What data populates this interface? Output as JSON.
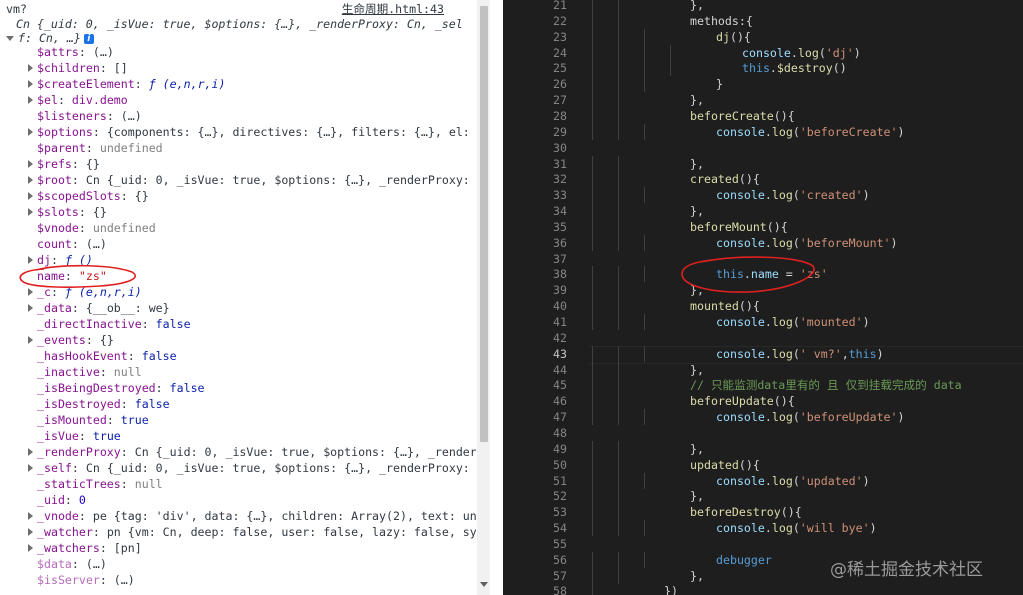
{
  "console": {
    "header": {
      "prompt": "vm?",
      "source_link": "生命周期.html:43"
    },
    "summary": "Cn {_uid: 0, _isVue: true, $options: {…}, _renderProxy: Cn, _sel",
    "summary2": "f: Cn, …}",
    "info_icon": "i",
    "rows": [
      {
        "tri": "none",
        "key": "$attrs",
        "sep": ": ",
        "val": "(…)",
        "vt": "obj"
      },
      {
        "tri": "closed",
        "key": "$children",
        "sep": ": ",
        "val": "[]",
        "vt": "obj"
      },
      {
        "tri": "closed",
        "key": "$createElement",
        "sep": ": ",
        "val": "ƒ (e,n,r,i)",
        "vt": "fn"
      },
      {
        "tri": "closed",
        "key": "$el",
        "sep": ": ",
        "val": "div.demo",
        "vt": "elem"
      },
      {
        "tri": "none",
        "key": "$listeners",
        "sep": ": ",
        "val": "(…)",
        "vt": "obj"
      },
      {
        "tri": "closed",
        "key": "$options",
        "sep": ": ",
        "val": "{components: {…}, directives: {…}, filters: {…}, el:",
        "vt": "obj"
      },
      {
        "tri": "none",
        "key": "$parent",
        "sep": ": ",
        "val": "undefined",
        "vt": "null"
      },
      {
        "tri": "closed",
        "key": "$refs",
        "sep": ": ",
        "val": "{}",
        "vt": "obj"
      },
      {
        "tri": "closed",
        "key": "$root",
        "sep": ": ",
        "val": "Cn {_uid: 0, _isVue: true, $options: {…}, _renderProxy:",
        "vt": "obj"
      },
      {
        "tri": "closed",
        "key": "$scopedSlots",
        "sep": ": ",
        "val": "{}",
        "vt": "obj"
      },
      {
        "tri": "closed",
        "key": "$slots",
        "sep": ": ",
        "val": "{}",
        "vt": "obj"
      },
      {
        "tri": "none",
        "key": "$vnode",
        "sep": ": ",
        "val": "undefined",
        "vt": "null"
      },
      {
        "tri": "none",
        "key": "count",
        "sep": ": ",
        "val": "(…)",
        "vt": "obj"
      },
      {
        "tri": "closed",
        "key": "dj",
        "sep": ": ",
        "val": "ƒ ()",
        "vt": "fn"
      },
      {
        "tri": "none",
        "key": "name",
        "sep": ": ",
        "val": "\"zs\"",
        "vt": "str"
      },
      {
        "tri": "closed",
        "key": "_c",
        "sep": ": ",
        "val": "ƒ (e,n,r,i)",
        "vt": "fn"
      },
      {
        "tri": "closed",
        "key": "_data",
        "sep": ": ",
        "val": "{__ob__: we}",
        "vt": "obj"
      },
      {
        "tri": "none",
        "key": "_directInactive",
        "sep": ": ",
        "val": "false",
        "vt": "kw"
      },
      {
        "tri": "closed",
        "key": "_events",
        "sep": ": ",
        "val": "{}",
        "vt": "obj"
      },
      {
        "tri": "none",
        "key": "_hasHookEvent",
        "sep": ": ",
        "val": "false",
        "vt": "kw"
      },
      {
        "tri": "none",
        "key": "_inactive",
        "sep": ": ",
        "val": "null",
        "vt": "null"
      },
      {
        "tri": "none",
        "key": "_isBeingDestroyed",
        "sep": ": ",
        "val": "false",
        "vt": "kw"
      },
      {
        "tri": "none",
        "key": "_isDestroyed",
        "sep": ": ",
        "val": "false",
        "vt": "kw"
      },
      {
        "tri": "none",
        "key": "_isMounted",
        "sep": ": ",
        "val": "true",
        "vt": "kw"
      },
      {
        "tri": "none",
        "key": "_isVue",
        "sep": ": ",
        "val": "true",
        "vt": "kw"
      },
      {
        "tri": "closed",
        "key": "_renderProxy",
        "sep": ": ",
        "val": "Cn {_uid: 0, _isVue: true, $options: {…}, _render",
        "vt": "obj"
      },
      {
        "tri": "closed",
        "key": "_self",
        "sep": ": ",
        "val": "Cn {_uid: 0, _isVue: true, $options: {…}, _renderProxy:",
        "vt": "obj"
      },
      {
        "tri": "none",
        "key": "_staticTrees",
        "sep": ": ",
        "val": "null",
        "vt": "null"
      },
      {
        "tri": "none",
        "key": "_uid",
        "sep": ": ",
        "val": "0",
        "vt": "num"
      },
      {
        "tri": "closed",
        "key": "_vnode",
        "sep": ": ",
        "val": "pe {tag: 'div', data: {…}, children: Array(2), text: un",
        "vt": "obj"
      },
      {
        "tri": "closed",
        "key": "_watcher",
        "sep": ": ",
        "val": "pn {vm: Cn, deep: false, user: false, lazy: false, sy",
        "vt": "obj"
      },
      {
        "tri": "closed",
        "key": "_watchers",
        "sep": ": ",
        "val": "[pn]",
        "vt": "obj"
      },
      {
        "tri": "none",
        "key": "$data",
        "sep": ": ",
        "val": "(…)",
        "vt": "obj",
        "dim": true
      },
      {
        "tri": "none",
        "key": "$isServer",
        "sep": ": ",
        "val": "(…)",
        "vt": "obj",
        "dim": true
      }
    ]
  },
  "editor": {
    "lines": [
      {
        "n": "21",
        "indent": 3,
        "tokens": [
          [
            "p",
            "},"
          ]
        ]
      },
      {
        "n": "22",
        "indent": 3,
        "tokens": [
          [
            "p",
            "methods:{"
          ]
        ]
      },
      {
        "n": "23",
        "indent": 4,
        "tokens": [
          [
            "fn",
            "dj"
          ],
          [
            "p",
            "(){"
          ]
        ]
      },
      {
        "n": "24",
        "indent": 5,
        "tokens": [
          [
            "v",
            "console"
          ],
          [
            "p",
            "."
          ],
          [
            "fn",
            "log"
          ],
          [
            "p",
            "("
          ],
          [
            "s",
            "'dj'"
          ],
          [
            "p",
            ")"
          ]
        ]
      },
      {
        "n": "25",
        "indent": 5,
        "tokens": [
          [
            "k",
            "this"
          ],
          [
            "p",
            "."
          ],
          [
            "fn",
            "$destroy"
          ],
          [
            "p",
            "()"
          ]
        ]
      },
      {
        "n": "26",
        "indent": 4,
        "tokens": [
          [
            "p",
            "}"
          ]
        ]
      },
      {
        "n": "27",
        "indent": 3,
        "tokens": [
          [
            "p",
            "},"
          ]
        ]
      },
      {
        "n": "28",
        "indent": 3,
        "tokens": [
          [
            "fn",
            "beforeCreate"
          ],
          [
            "p",
            "(){"
          ]
        ]
      },
      {
        "n": "29",
        "indent": 4,
        "tokens": [
          [
            "v",
            "console"
          ],
          [
            "p",
            "."
          ],
          [
            "fn",
            "log"
          ],
          [
            "p",
            "("
          ],
          [
            "s",
            "'beforeCreate'"
          ],
          [
            "p",
            ")"
          ]
        ]
      },
      {
        "n": "30",
        "indent": 0,
        "tokens": []
      },
      {
        "n": "31",
        "indent": 3,
        "tokens": [
          [
            "p",
            "},"
          ]
        ]
      },
      {
        "n": "32",
        "indent": 3,
        "tokens": [
          [
            "fn",
            "created"
          ],
          [
            "p",
            "(){"
          ]
        ]
      },
      {
        "n": "33",
        "indent": 4,
        "tokens": [
          [
            "v",
            "console"
          ],
          [
            "p",
            "."
          ],
          [
            "fn",
            "log"
          ],
          [
            "p",
            "("
          ],
          [
            "s",
            "'created'"
          ],
          [
            "p",
            ")"
          ]
        ]
      },
      {
        "n": "34",
        "indent": 3,
        "tokens": [
          [
            "p",
            "},"
          ]
        ]
      },
      {
        "n": "35",
        "indent": 3,
        "tokens": [
          [
            "fn",
            "beforeMount"
          ],
          [
            "p",
            "(){"
          ]
        ]
      },
      {
        "n": "36",
        "indent": 4,
        "tokens": [
          [
            "v",
            "console"
          ],
          [
            "p",
            "."
          ],
          [
            "fn",
            "log"
          ],
          [
            "p",
            "("
          ],
          [
            "s",
            "'beforeMount'"
          ],
          [
            "p",
            ")"
          ]
        ]
      },
      {
        "n": "37",
        "indent": 0,
        "tokens": []
      },
      {
        "n": "38",
        "indent": 4,
        "tokens": [
          [
            "k",
            "this"
          ],
          [
            "p",
            "."
          ],
          [
            "v",
            "name"
          ],
          [
            "p",
            " = "
          ],
          [
            "s",
            "'zs'"
          ]
        ]
      },
      {
        "n": "39",
        "indent": 3,
        "tokens": [
          [
            "p",
            "},"
          ]
        ]
      },
      {
        "n": "40",
        "indent": 3,
        "tokens": [
          [
            "fn",
            "mounted"
          ],
          [
            "p",
            "(){"
          ]
        ]
      },
      {
        "n": "41",
        "indent": 4,
        "tokens": [
          [
            "v",
            "console"
          ],
          [
            "p",
            "."
          ],
          [
            "fn",
            "log"
          ],
          [
            "p",
            "("
          ],
          [
            "s",
            "'mounted'"
          ],
          [
            "p",
            ")"
          ]
        ]
      },
      {
        "n": "42",
        "indent": 0,
        "tokens": []
      },
      {
        "n": "43",
        "indent": 4,
        "tokens": [
          [
            "v",
            "console"
          ],
          [
            "p",
            "."
          ],
          [
            "fn",
            "log"
          ],
          [
            "p",
            "("
          ],
          [
            "s",
            "' vm?'"
          ],
          [
            "p",
            ","
          ],
          [
            "k",
            "this"
          ],
          [
            "p",
            ")"
          ]
        ],
        "current": true
      },
      {
        "n": "44",
        "indent": 3,
        "tokens": [
          [
            "p",
            "},"
          ]
        ]
      },
      {
        "n": "45",
        "indent": 3,
        "tokens": [
          [
            "c",
            "// 只能监测data里有的 且 仅到挂载完成的 data"
          ]
        ]
      },
      {
        "n": "46",
        "indent": 3,
        "tokens": [
          [
            "fn",
            "beforeUpdate"
          ],
          [
            "p",
            "(){"
          ]
        ]
      },
      {
        "n": "47",
        "indent": 4,
        "tokens": [
          [
            "v",
            "console"
          ],
          [
            "p",
            "."
          ],
          [
            "fn",
            "log"
          ],
          [
            "p",
            "("
          ],
          [
            "s",
            "'beforeUpdate'"
          ],
          [
            "p",
            ")"
          ]
        ]
      },
      {
        "n": "48",
        "indent": 0,
        "tokens": []
      },
      {
        "n": "49",
        "indent": 3,
        "tokens": [
          [
            "p",
            "},"
          ]
        ]
      },
      {
        "n": "50",
        "indent": 3,
        "tokens": [
          [
            "fn",
            "updated"
          ],
          [
            "p",
            "(){"
          ]
        ]
      },
      {
        "n": "51",
        "indent": 4,
        "tokens": [
          [
            "v",
            "console"
          ],
          [
            "p",
            "."
          ],
          [
            "fn",
            "log"
          ],
          [
            "p",
            "("
          ],
          [
            "s",
            "'updated'"
          ],
          [
            "p",
            ")"
          ]
        ]
      },
      {
        "n": "52",
        "indent": 3,
        "tokens": [
          [
            "p",
            "},"
          ]
        ]
      },
      {
        "n": "53",
        "indent": 3,
        "tokens": [
          [
            "fn",
            "beforeDestroy"
          ],
          [
            "p",
            "(){"
          ]
        ]
      },
      {
        "n": "54",
        "indent": 4,
        "tokens": [
          [
            "v",
            "console"
          ],
          [
            "p",
            "."
          ],
          [
            "fn",
            "log"
          ],
          [
            "p",
            "("
          ],
          [
            "s",
            "'will bye'"
          ],
          [
            "p",
            ")"
          ]
        ]
      },
      {
        "n": "55",
        "indent": 0,
        "tokens": []
      },
      {
        "n": "56",
        "indent": 4,
        "tokens": [
          [
            "k",
            "debugger"
          ]
        ]
      },
      {
        "n": "57",
        "indent": 3,
        "tokens": [
          [
            "p",
            "},"
          ]
        ]
      },
      {
        "n": "58",
        "indent": 2,
        "tokens": [
          [
            "p",
            "})"
          ]
        ]
      }
    ]
  },
  "watermark": "@稀土掘金技术社区",
  "colors": {
    "annotation": "#e02020",
    "editor_bg": "#1e1e1e"
  }
}
